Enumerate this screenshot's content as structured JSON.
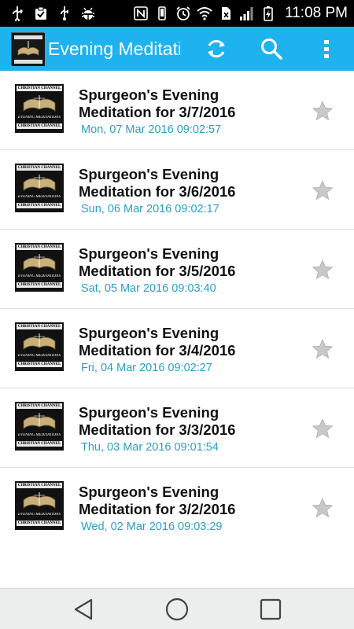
{
  "status_bar": {
    "time": "11:08 PM",
    "left_icons": [
      "usb-icon",
      "clipboard-check-icon",
      "usb-debug-icon",
      "android-debug-icon"
    ],
    "right_icons": [
      "nfc-icon",
      "vibrate-icon",
      "alarm-icon",
      "wifi-icon",
      "sim-icon",
      "signal-icon",
      "battery-charging-icon"
    ]
  },
  "action_bar": {
    "title": "Evening Meditations",
    "icons": [
      "refresh-icon",
      "search-icon",
      "overflow-menu-icon"
    ],
    "color": "#1eb2ee"
  },
  "thumb": {
    "top_band": "CHRISTIAN CHANNEL",
    "middle": "EVENING MEDITATIONS",
    "bottom_band": "CHRISTIAN CHANNEL"
  },
  "items": [
    {
      "title": "Spurgeon's Evening Meditation for 3/7/2016",
      "date": "Mon, 07 Mar 2016 09:02:57"
    },
    {
      "title": "Spurgeon's Evening Meditation for 3/6/2016",
      "date": "Sun, 06 Mar 2016 09:02:17"
    },
    {
      "title": "Spurgeon's Evening Meditation for 3/5/2016",
      "date": "Sat, 05 Mar 2016 09:03:40"
    },
    {
      "title": "Spurgeon's Evening Meditation for 3/4/2016",
      "date": "Fri, 04 Mar 2016 09:02:27"
    },
    {
      "title": "Spurgeon's Evening Meditation for 3/3/2016",
      "date": "Thu, 03 Mar 2016 09:01:54"
    },
    {
      "title": "Spurgeon's Evening Meditation for 3/2/2016",
      "date": "Wed, 02 Mar 2016 09:03:29"
    }
  ],
  "nav_bar": {
    "icons": [
      "back-icon",
      "home-icon",
      "recent-apps-icon"
    ]
  },
  "colors": {
    "date_text": "#2a9fc6",
    "star": "#c8c8c8",
    "divider": "#dcdcdc"
  }
}
